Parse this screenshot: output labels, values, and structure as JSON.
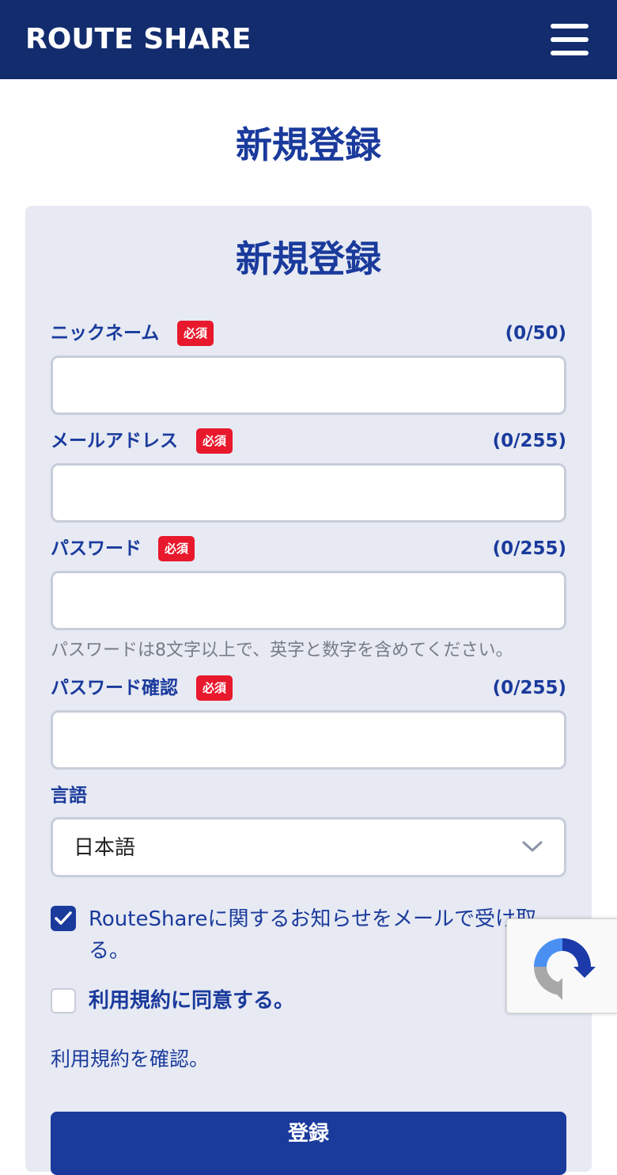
{
  "header": {
    "logo": "ROUTE SHARE",
    "menu_icon": "hamburger-menu-icon"
  },
  "page": {
    "title": "新規登録"
  },
  "form": {
    "title": "新規登録",
    "required_badge": "必須",
    "fields": {
      "nickname": {
        "label": "ニックネーム",
        "count": "(0/50)",
        "value": ""
      },
      "email": {
        "label": "メールアドレス",
        "count": "(0/255)",
        "value": ""
      },
      "password": {
        "label": "パスワード",
        "count": "(0/255)",
        "value": "",
        "hint": "パスワードは8文字以上で、英字と数字を含めてください。"
      },
      "password_confirm": {
        "label": "パスワード確認",
        "count": "(0/255)",
        "value": ""
      }
    },
    "language": {
      "label": "言語",
      "selected": "日本語"
    },
    "newsletter": {
      "checked": true,
      "label_line1": "RouteShareに関するお知らせをメールで受け取",
      "label_line2": "る。"
    },
    "terms_agree": {
      "checked": false,
      "label": "利用規約に同意する。"
    },
    "terms_link": "利用規約を確認。",
    "submit_label": "登録"
  },
  "colors": {
    "header_bg": "#132c6e",
    "brand_blue": "#1a3a9c",
    "required_red": "#e8192c",
    "card_bg": "#e7eaf3"
  }
}
